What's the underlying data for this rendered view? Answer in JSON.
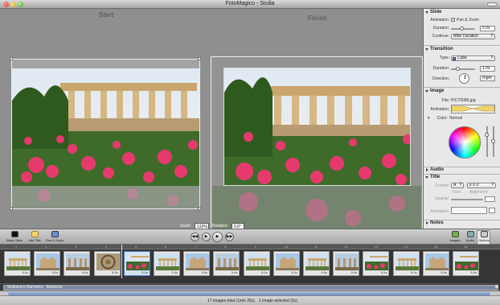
{
  "window": {
    "title": "FotoMagico - Sicilia"
  },
  "stage": {
    "start_label": "Start",
    "finish_label": "Finish",
    "zoom_label": "Zoom:",
    "zoom_value": "132%",
    "rotation_label": "Rotation:",
    "rotation_value": "0.0°"
  },
  "inspector": {
    "slide": {
      "title": "Slide",
      "animation_label": "Animation:",
      "animation_checkbox": "Pan & Zoom",
      "animation_checked": true,
      "duration_label": "Duration:",
      "duration_value": "5.0s",
      "continue_label": "Continue:",
      "continue_value": "After Duration"
    },
    "transition": {
      "title": "Transition",
      "type_label": "Type:",
      "type_value": "Cube",
      "duration_label": "Duration:",
      "duration_value": "1.0s",
      "direction_label": "Direction:",
      "direction_value": "Right"
    },
    "image": {
      "title": "Image",
      "file_label": "File:",
      "file_value": "PICT0086.jpg",
      "animation_label": "Animation:",
      "color_label": "Color:",
      "color_value": "Normal"
    },
    "audio": {
      "title": "Audio"
    },
    "title_section": {
      "title": "Title",
      "format_label": "Format:",
      "font_label": "Font",
      "alignment_label": "Alignment",
      "opacity_label": "Opacity:",
      "animation_label": "Animation:"
    },
    "notes": {
      "title": "Notes"
    }
  },
  "toolbar": {
    "black_slide": "Black Slide",
    "add_title": "Add Title",
    "pan_zoom": "Pan & Zoom",
    "images": "Images",
    "audio": "Audio",
    "options": "Options"
  },
  "lighttable": {
    "ruler_marks": [
      "1",
      "2",
      "3",
      "4",
      "5",
      "6",
      "7",
      "8",
      "9",
      "10",
      "11",
      "12",
      "13",
      "14",
      "15",
      "16"
    ],
    "slides": [
      {
        "dur": "5.0s",
        "scene": "temple"
      },
      {
        "dur": "5.0s",
        "scene": "cathedral"
      },
      {
        "dur": "5.0s",
        "scene": "ruins"
      },
      {
        "dur": "5.0s",
        "scene": "mosaic"
      },
      {
        "dur": "5.0s",
        "scene": "flowers",
        "selected": true
      },
      {
        "dur": "5.0s",
        "scene": "temple"
      },
      {
        "dur": "5.0s",
        "scene": "cathedral"
      },
      {
        "dur": "5.0s",
        "scene": "ruins"
      },
      {
        "dur": "5.0s",
        "scene": "temple"
      },
      {
        "dur": "5.0s",
        "scene": "cathedral"
      },
      {
        "dur": "5.0s",
        "scene": "temple"
      },
      {
        "dur": "5.0s",
        "scene": "ruins"
      },
      {
        "dur": "5.0s",
        "scene": "flowers"
      },
      {
        "dur": "5.0s",
        "scene": "temple"
      },
      {
        "dur": "5.0s",
        "scene": "cathedral"
      },
      {
        "dur": "5.0s",
        "scene": "flowers"
      }
    ],
    "audio_clip": "Siciliana e Barbieria · Barbieria"
  },
  "status": {
    "left": "17 images total (1min 25s)",
    "right": "1 image selected (5s)"
  },
  "colors": {
    "accent": "#4d7fd9",
    "stage": "#8f8f8f",
    "lighttable": "#353535"
  }
}
